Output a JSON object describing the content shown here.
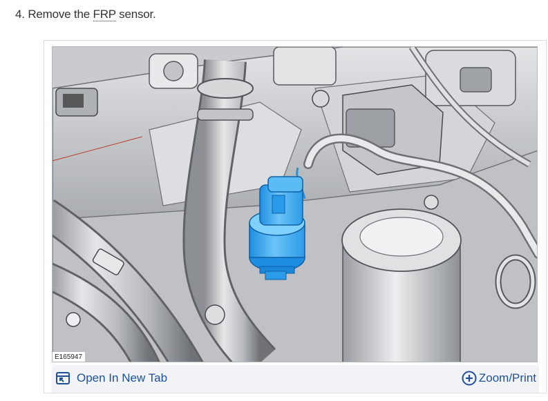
{
  "step": {
    "number": "4.",
    "text_before": "Remove the",
    "abbreviation": "FRP",
    "text_after": "sensor."
  },
  "figure": {
    "id_label": "E165947",
    "open_tab_label": "Open In New Tab",
    "zoom_label": "Zoom/Print",
    "open_tab_icon": "open-new-tab-icon",
    "zoom_icon": "plus-circle-icon",
    "colors": {
      "link": "#1f4f96",
      "sensor": "#3fa9ec",
      "bar_background": "#f1f3f6"
    }
  }
}
